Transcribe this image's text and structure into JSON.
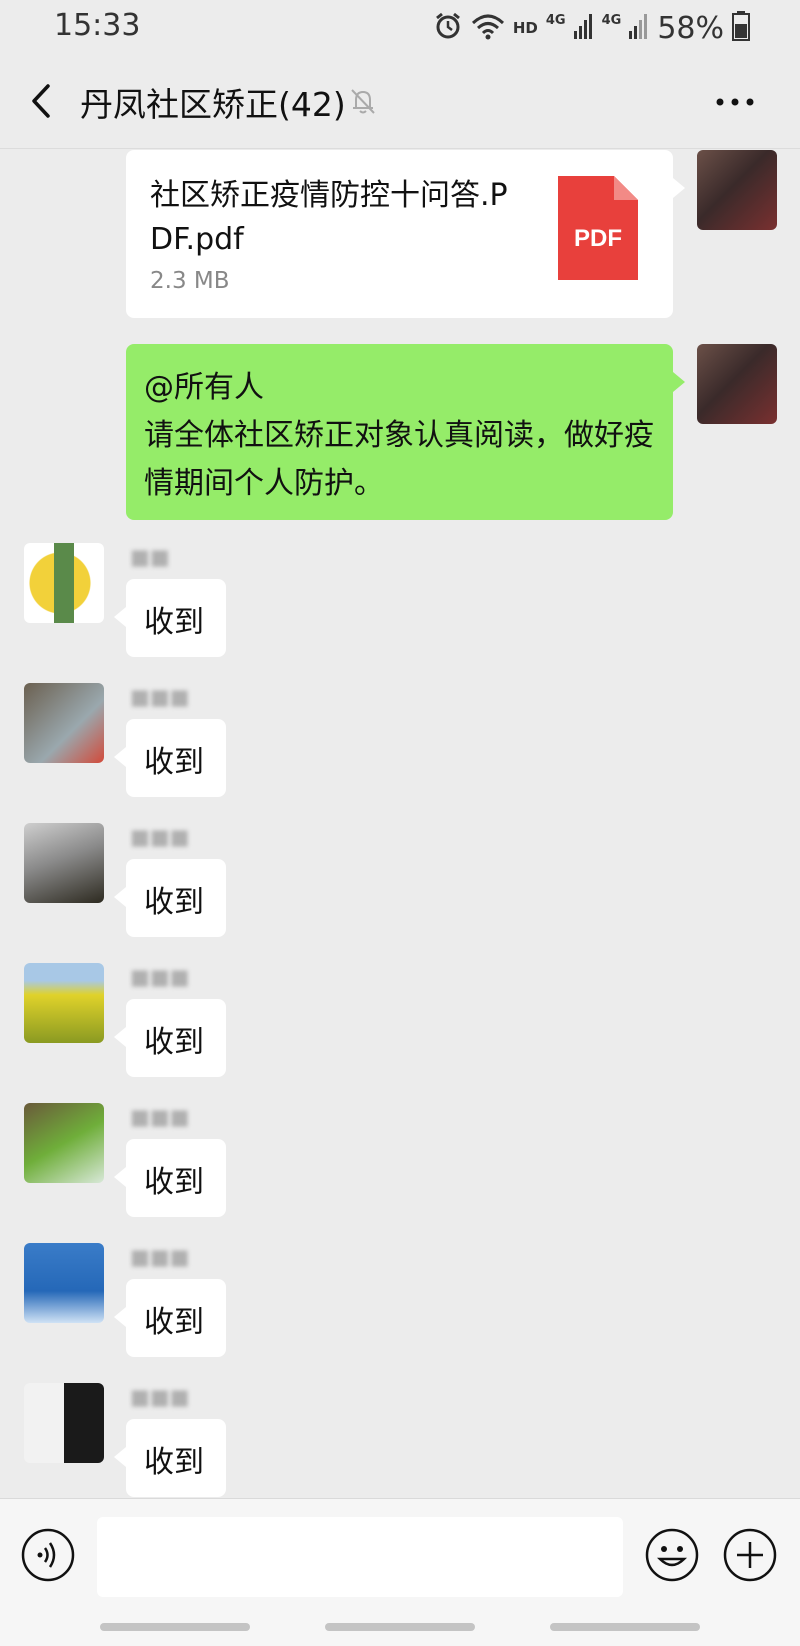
{
  "status_bar": {
    "time": "15:33",
    "hd_label": "HD",
    "network_1": "4G",
    "network_2": "4G",
    "battery": "58%"
  },
  "header": {
    "title": "丹凤社区矫正(42)"
  },
  "messages": {
    "file": {
      "name": "社区矫正疫情防控十问答.PDF.pdf",
      "size": "2.3 MB",
      "icon_label": "PDF"
    },
    "announcement": {
      "line1": "@所有人",
      "line2": "请全体社区矫正对象认真阅读，做好疫情期间个人防护。"
    },
    "replies": [
      {
        "text": "收到"
      },
      {
        "text": "收到"
      },
      {
        "text": "收到"
      },
      {
        "text": "收到"
      },
      {
        "text": "收到"
      },
      {
        "text": "收到"
      },
      {
        "text": "收到"
      }
    ]
  },
  "colors": {
    "sent_bubble": "#95ec69",
    "received_bubble": "#ffffff",
    "background": "#ececec",
    "pdf_red": "#e8403c"
  },
  "icons": [
    "back-icon",
    "mute-bell-icon",
    "more-icon",
    "alarm-icon",
    "wifi-icon",
    "signal-icon",
    "battery-icon",
    "pdf-file-icon",
    "voice-icon",
    "emoji-icon",
    "plus-icon"
  ]
}
